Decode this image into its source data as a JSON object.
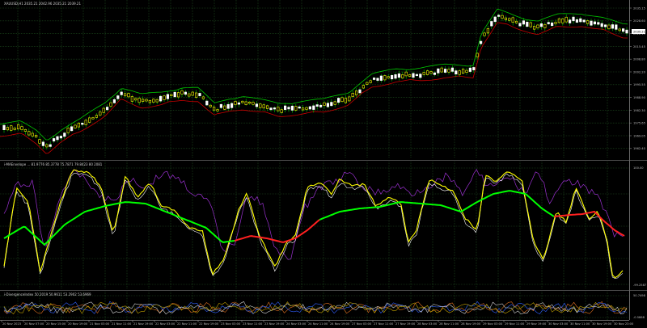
{
  "symbol_header": "XAUUSD,H1  2035.21  2042.96  2035.21  2039.21",
  "indicator1_header": "i-MAEnvelope ... 81.9776  85.3778  75.7871  79.8423  80  2081",
  "indicator2_header": "i-DivergenceIndex  50.2019  50.9611  53.2902  53.6969",
  "price_axis": [
    "2035.15",
    "2028.60",
    "2022.15",
    "2015.45",
    "2008.80",
    "2002.20",
    "1995.55",
    "1988.90",
    "1982.30",
    "1975.65",
    "1969.05",
    "1962.40"
  ],
  "current_price": "2039.21",
  "osc_axis_top": "100.00",
  "osc_axis_bottom": "-99.2587",
  "div_axis_top": "50.7498",
  "div_axis_bottom": "-0.5868",
  "time_axis": [
    "20 Nov 2023",
    "20 Nov 07:00",
    "20 Nov 15:00",
    "20 Nov 19:00",
    "21 Nov 03:00",
    "21 Nov 11:00",
    "21 Nov 19:00",
    "22 Nov 03:00",
    "22 Nov 11:00",
    "22 Nov 19:00",
    "23 Nov 03:00",
    "23 Nov 11:00",
    "23 Nov 19:00",
    "24 Nov 03:00",
    "24 Nov 11:00",
    "24 Nov 19:00",
    "27 Nov 03:00",
    "27 Nov 11:00",
    "27 Nov 19:00",
    "28 Nov 03:00",
    "28 Nov 11:00",
    "28 Nov 19:00",
    "29 Nov 03:00",
    "29 Nov 11:00",
    "29 Nov 19:00",
    "30 Nov 03:00",
    "30 Nov 11:00",
    "30 Nov 19:00",
    "30 Nov 23:00"
  ],
  "colors": {
    "background": "#000000",
    "grid": "#1e4d1e",
    "bull_candle": "#ffffff",
    "bear_candle": "#ffff00",
    "envelope_upper": "#00c800",
    "envelope_lower": "#c80000",
    "osc_fast": "#ffff00",
    "osc_slow": "#ffffff",
    "osc_purple": "#9a30d0",
    "osc_trend_up": "#00ff00",
    "osc_trend_down": "#ff2020"
  }
}
